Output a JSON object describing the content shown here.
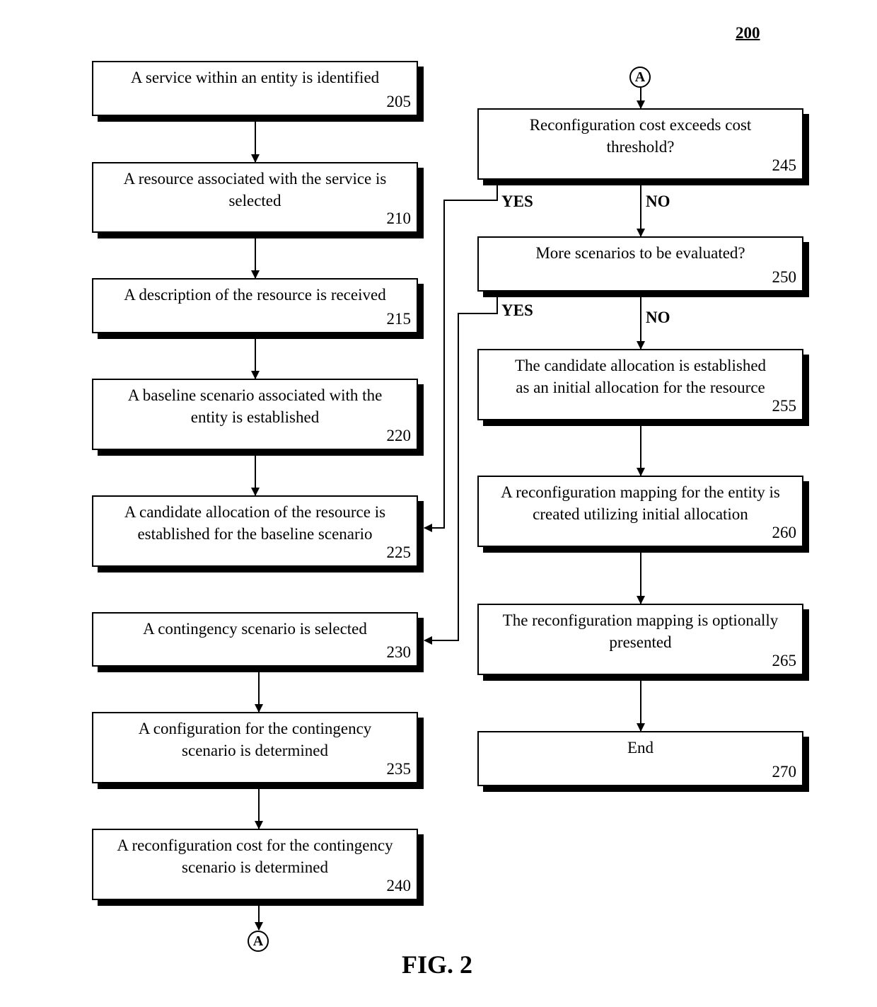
{
  "figure": {
    "number": "200",
    "title": "FIG. 2"
  },
  "connector_label": "A",
  "steps": {
    "s205": {
      "text": "A service within an entity is identified",
      "ref": "205"
    },
    "s210": {
      "text": "A resource associated with the service is selected",
      "ref": "210"
    },
    "s215": {
      "text": "A description of the resource is received",
      "ref": "215"
    },
    "s220": {
      "text": "A baseline scenario associated with the entity is established",
      "ref": "220"
    },
    "s225": {
      "text": "A candidate allocation of the resource is established for the baseline scenario",
      "ref": "225"
    },
    "s230": {
      "text": "A contingency scenario is selected",
      "ref": "230"
    },
    "s235": {
      "text": "A configuration for the contingency scenario is determined",
      "ref": "235"
    },
    "s240": {
      "text": "A reconfiguration cost for the contingency scenario is determined",
      "ref": "240"
    },
    "s245": {
      "text": "Reconfiguration cost exceeds cost threshold?",
      "ref": "245"
    },
    "s250": {
      "text": "More scenarios to be evaluated?",
      "ref": "250"
    },
    "s255": {
      "text": "The candidate allocation is established as an initial allocation for the resource",
      "ref": "255"
    },
    "s260": {
      "text": "A reconfiguration mapping for the entity is created utilizing initial allocation",
      "ref": "260"
    },
    "s265": {
      "text": "The reconfiguration mapping is optionally presented",
      "ref": "265"
    },
    "s270": {
      "text": "End",
      "ref": "270"
    }
  },
  "branch_labels": {
    "yes": "YES",
    "no": "NO"
  }
}
